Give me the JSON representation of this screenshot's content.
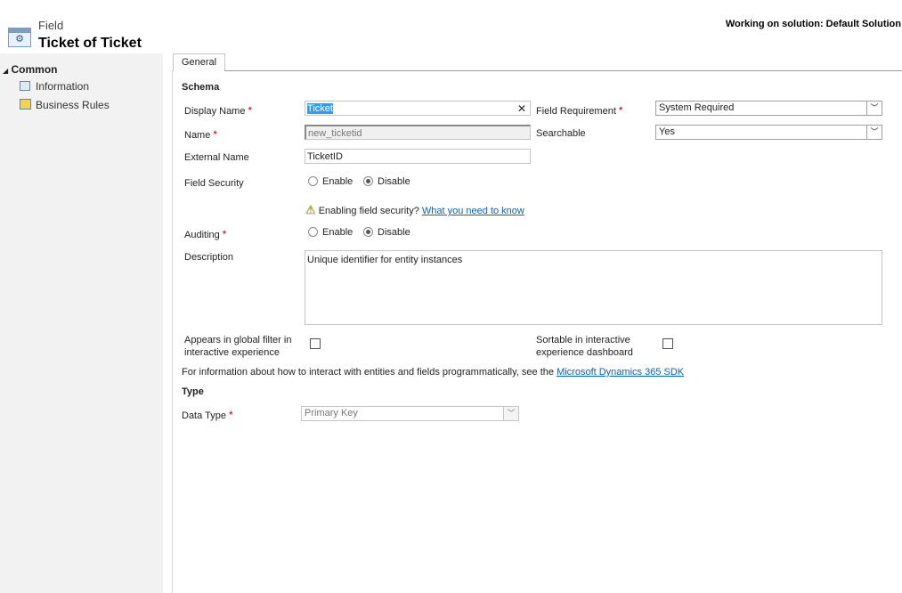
{
  "header": {
    "entity_type": "Field",
    "title": "Ticket of Ticket",
    "solution": "Working on solution: Default Solution"
  },
  "sidebar": {
    "section": "Common",
    "items": [
      {
        "label": "Information",
        "icon": "information-icon"
      },
      {
        "label": "Business Rules",
        "icon": "business-rules-icon"
      }
    ]
  },
  "tabs": [
    {
      "label": "General",
      "active": true
    }
  ],
  "schema": {
    "heading": "Schema",
    "display_name": {
      "label": "Display Name",
      "value": "Ticket"
    },
    "name": {
      "label": "Name",
      "value": "new_ticketid"
    },
    "external_name": {
      "label": "External Name",
      "value": "TicketID"
    },
    "field_security": {
      "label": "Field Security",
      "options": [
        "Enable",
        "Disable"
      ],
      "selected": "Disable"
    },
    "warning": {
      "text": "Enabling field security?",
      "link": "What you need to know"
    },
    "auditing": {
      "label": "Auditing",
      "options": [
        "Enable",
        "Disable"
      ],
      "selected": "Disable"
    },
    "description": {
      "label": "Description",
      "value": "Unique identifier for entity instances"
    },
    "field_requirement": {
      "label": "Field Requirement",
      "value": "System Required"
    },
    "searchable": {
      "label": "Searchable",
      "value": "Yes"
    },
    "global_filter": {
      "label": "Appears in global filter in interactive experience",
      "checked": false
    },
    "sortable": {
      "label": "Sortable in interactive experience dashboard",
      "checked": false
    },
    "sdk_text": "For information about how to interact with entities and fields programmatically, see the",
    "sdk_link": "Microsoft Dynamics 365 SDK"
  },
  "type": {
    "heading": "Type",
    "data_type": {
      "label": "Data Type",
      "value": "Primary Key"
    }
  },
  "required_mark": "*",
  "colors": {
    "link": "#0563c1",
    "required": "#c00000",
    "sidebar": "#f2f2f2",
    "selection": "#3399ff"
  }
}
